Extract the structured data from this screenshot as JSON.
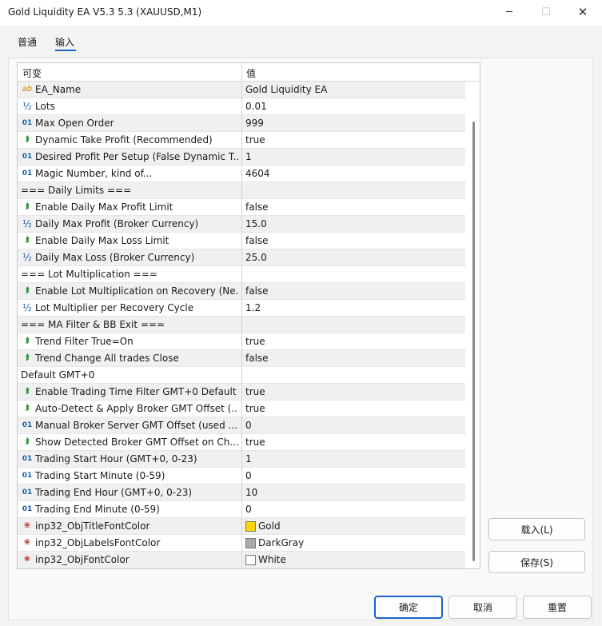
{
  "window": {
    "title": "Gold Liquidity EA V5.3 5.3 (XAUUSD,M1)",
    "minimize_glyph": "─",
    "maximize_glyph": "☐",
    "close_glyph": "✕"
  },
  "tabs": [
    {
      "label": "普通",
      "active": false
    },
    {
      "label": "输入",
      "active": true
    }
  ],
  "grid": {
    "header_name": "可变",
    "header_value": "值"
  },
  "params": [
    {
      "icon": "ab",
      "name": "EA_Name",
      "value": "Gold Liquidity EA"
    },
    {
      "icon": "half",
      "name": "Lots",
      "value": "0.01"
    },
    {
      "icon": "num",
      "name": "Max Open Order",
      "value": "999"
    },
    {
      "icon": "bool",
      "name": "Dynamic Take Profit (Recommended)",
      "value": "true"
    },
    {
      "icon": "num",
      "name": "Desired Profit Per Setup (False Dynamic T...",
      "value": "1"
    },
    {
      "icon": "num",
      "name": "Magic Number, kind of...",
      "value": "4604"
    },
    {
      "icon": "none",
      "name": "=== Daily Limits ===",
      "value": ""
    },
    {
      "icon": "bool",
      "name": "Enable Daily Max Profit Limit",
      "value": "false"
    },
    {
      "icon": "half",
      "name": "Daily Max Profit (Broker Currency)",
      "value": "15.0"
    },
    {
      "icon": "bool",
      "name": "Enable Daily Max Loss Limit",
      "value": "false"
    },
    {
      "icon": "half",
      "name": "Daily Max Loss (Broker Currency)",
      "value": "25.0"
    },
    {
      "icon": "none",
      "name": "=== Lot Multiplication ===",
      "value": ""
    },
    {
      "icon": "bool",
      "name": "Enable Lot Multiplication on Recovery (Ne...",
      "value": "false"
    },
    {
      "icon": "half",
      "name": "Lot Multiplier per Recovery Cycle",
      "value": "1.2"
    },
    {
      "icon": "none",
      "name": "=== MA Filter & BB Exit ===",
      "value": ""
    },
    {
      "icon": "bool",
      "name": "Trend Filter True=On",
      "value": "true"
    },
    {
      "icon": "bool",
      "name": "Trend Change All trades Close",
      "value": "false"
    },
    {
      "icon": "none",
      "name": "Default GMT+0",
      "value": ""
    },
    {
      "icon": "bool",
      "name": "Enable Trading Time Filter GMT+0 Default",
      "value": "true"
    },
    {
      "icon": "bool",
      "name": "Auto-Detect & Apply Broker GMT Offset (...",
      "value": "true"
    },
    {
      "icon": "num",
      "name": "Manual Broker Server GMT Offset (used ...",
      "value": "0"
    },
    {
      "icon": "bool",
      "name": "Show Detected Broker GMT Offset on Ch...",
      "value": "true"
    },
    {
      "icon": "num",
      "name": "Trading Start Hour (GMT+0, 0-23)",
      "value": "1"
    },
    {
      "icon": "num",
      "name": "Trading Start Minute (0-59)",
      "value": "0"
    },
    {
      "icon": "num",
      "name": "Trading End Hour (GMT+0, 0-23)",
      "value": "10"
    },
    {
      "icon": "num",
      "name": "Trading End Minute (0-59)",
      "value": "0"
    },
    {
      "icon": "color",
      "name": "inp32_ObjTitleFontColor",
      "value": "Gold",
      "swatch": "#ffd700"
    },
    {
      "icon": "color",
      "name": "inp32_ObjLabelsFontColor",
      "value": "DarkGray",
      "swatch": "#a9a9a9"
    },
    {
      "icon": "color",
      "name": "inp32_ObjFontColor",
      "value": "White",
      "swatch": "#ffffff"
    }
  ],
  "icons": {
    "ab": "ab",
    "num": "01",
    "half": "½",
    "bool": "⮭",
    "color": "❀",
    "none": ""
  },
  "buttons": {
    "load": "载入(L)",
    "save": "保存(S)",
    "ok": "确定",
    "cancel": "取消",
    "reset": "重置"
  }
}
